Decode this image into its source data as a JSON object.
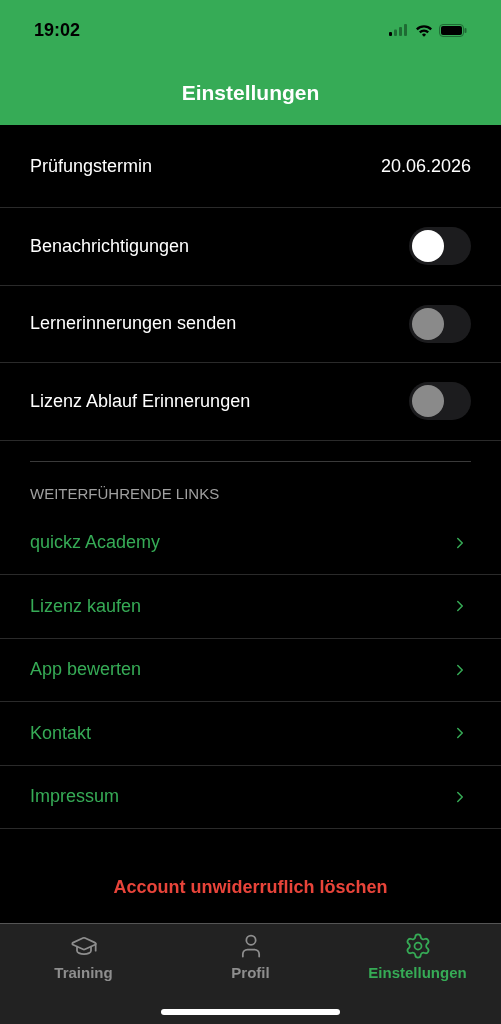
{
  "status_bar": {
    "time": "19:02"
  },
  "header": {
    "title": "Einstellungen"
  },
  "exam_date": {
    "label": "Prüfungstermin",
    "value": "20.06.2026"
  },
  "toggles": [
    {
      "label": "Benachrichtigungen",
      "on": false,
      "disabled": false
    },
    {
      "label": "Lernerinnerungen senden",
      "on": false,
      "disabled": true
    },
    {
      "label": "Lizenz Ablauf Erinnerungen",
      "on": false,
      "disabled": true
    }
  ],
  "links_section": {
    "heading": "WEITERFÜHRENDE LINKS",
    "items": [
      {
        "label": "quickz Academy"
      },
      {
        "label": "Lizenz kaufen"
      },
      {
        "label": "App bewerten"
      },
      {
        "label": "Kontakt"
      },
      {
        "label": "Impressum"
      }
    ]
  },
  "delete_account": "Account unwiderruflich löschen",
  "tabs": [
    {
      "kind": "training",
      "label": "Training",
      "selected": false
    },
    {
      "kind": "profile",
      "label": "Profil",
      "selected": false
    },
    {
      "kind": "settings",
      "label": "Einstellungen",
      "selected": true
    }
  ]
}
